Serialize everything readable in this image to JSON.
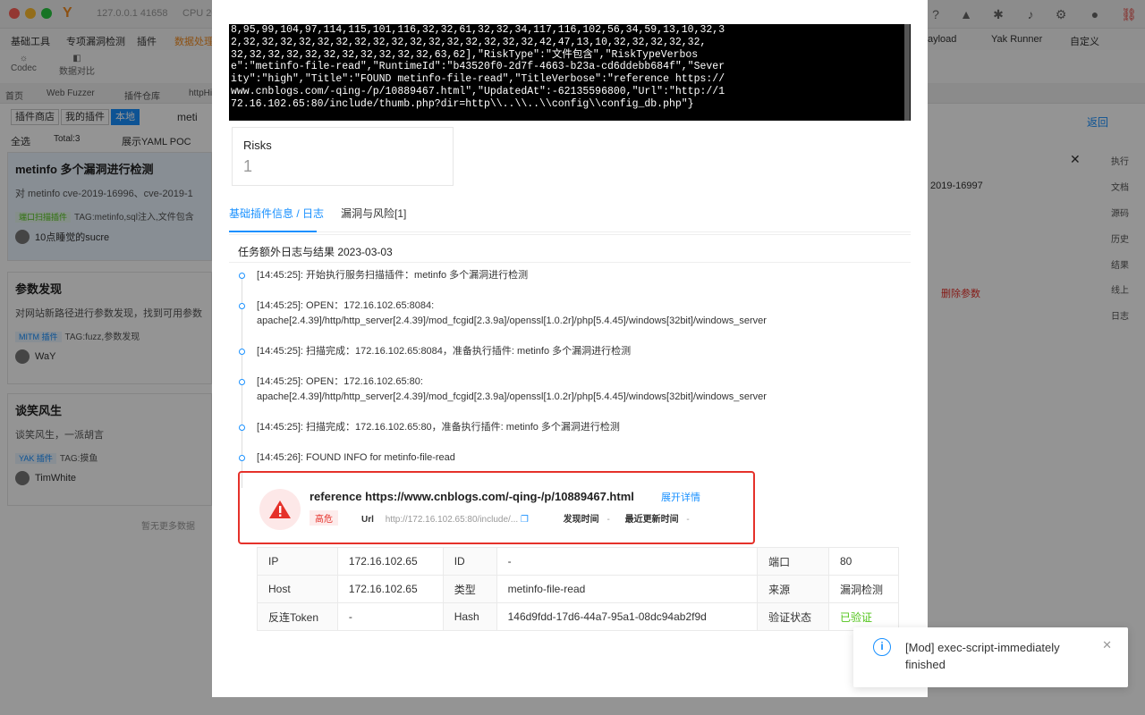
{
  "bg": {
    "address": "127.0.0.1 41658",
    "cpu": "CPU 20",
    "menu": [
      "基础工具",
      "专项漏洞检测",
      "插件",
      "数据处理"
    ],
    "menu_right": [
      "ayload",
      "Yak Runner",
      "自定义"
    ],
    "tools": [
      "Codec",
      "数据对比"
    ],
    "tabs": [
      "首页",
      "Web Fuzzer",
      "插件仓库",
      "httpHi"
    ],
    "plugin_tabs": [
      "插件商店",
      "我的插件",
      "本地"
    ],
    "search_value": "meti",
    "select_all": "全选",
    "total": "Total:3",
    "yaml_toggle": "展示YAML POC",
    "back_link": "返回",
    "cards": [
      {
        "title": "metinfo 多个漏洞进行检测",
        "desc": "对 metinfo cve-2019-16996、cve-2019-1",
        "tag": "端口扫描插件",
        "tags": "TAG:metinfo,sql注入,文件包含",
        "author": "10点睡觉的sucre"
      },
      {
        "title": "参数发现",
        "desc": "对网站新路径进行参数发现，找到可用参数",
        "tag": "MITM 插件",
        "tags": "TAG:fuzz,参数发现",
        "author": "WaY"
      },
      {
        "title": "谈笑风生",
        "desc": "谈笑风生，一派胡言",
        "tag": "YAK 插件",
        "tags": "TAG:摸鱼",
        "author": "TimWhite"
      }
    ],
    "no_more": "暂无更多数据",
    "right_field": "2019-16997",
    "delete_param": "删除参数",
    "side_tabs": [
      "执行",
      "文档",
      "源码",
      "历史",
      "结果",
      "线上",
      "日志"
    ]
  },
  "terminal_lines": [
    "8,95,99,104,97,114,115,101,116,32,32,61,32,32,34,117,116,102,56,34,59,13,10,32,3",
    "2,32,32,32,32,32,32,32,32,32,32,32,32,32,32,32,32,42,47,13,10,32,32,32,32,32,",
    "32,32,32,32,32,32,32,32,32,32,32,63,62],\"RiskType\":\"文件包含\",\"RiskTypeVerbos",
    "e\":\"metinfo-file-read\",\"RuntimeId\":\"b43520f0-2d7f-4663-b23a-cd6ddebb684f\",\"Sever",
    "ity\":\"high\",\"Title\":\"FOUND metinfo-file-read\",\"TitleVerbose\":\"reference https://",
    "www.cnblogs.com/-qing-/p/10889467.html\",\"UpdatedAt\":-62135596800,\"Url\":\"http://1",
    "72.16.102.65:80/include/thumb.php?dir=http\\\\..\\\\..\\\\config\\\\config_db.php\"}"
  ],
  "risks": {
    "label": "Risks",
    "value": "1"
  },
  "info_tabs": [
    "基础插件信息 / 日志",
    "漏洞与风险[1]"
  ],
  "log_header": "任务额外日志与结果  2023-03-03",
  "logs": [
    "[14:45:25]: 开始执行服务扫描插件：metinfo 多个漏洞进行检测",
    "[14:45:25]: OPEN：172.16.102.65:8084: apache[2.4.39]/http/http_server[2.4.39]/mod_fcgid[2.3.9a]/openssl[1.0.2r]/php[5.4.45]/windows[32bit]/windows_server",
    "[14:45:25]: 扫描完成：172.16.102.65:8084，准备执行插件: metinfo 多个漏洞进行检测",
    "[14:45:25]: OPEN：172.16.102.65:80: apache[2.4.39]/http/http_server[2.4.39]/mod_fcgid[2.3.9a]/openssl[1.0.2r]/php[5.4.45]/windows[32bit]/windows_server",
    "[14:45:25]: 扫描完成：172.16.102.65:80，准备执行插件: metinfo 多个漏洞进行检测",
    "[14:45:26]: FOUND INFO for metinfo-file-read"
  ],
  "risk_card": {
    "title": "reference https://www.cnblogs.com/-qing-/p/10889467.html",
    "expand": "展开详情",
    "severity": "高危",
    "url_label": "Url",
    "url_value": "http://172.16.102.65:80/include/...",
    "found_label": "发现时间",
    "found_value": "-",
    "updated_label": "最近更新时间",
    "updated_value": "-"
  },
  "details": [
    [
      "IP",
      "172.16.102.65",
      "ID",
      "-",
      "端口",
      "80"
    ],
    [
      "Host",
      "172.16.102.65",
      "类型",
      "metinfo-file-read",
      "来源",
      "漏洞检测"
    ],
    [
      "反连Token",
      "-",
      "Hash",
      "146d9fdd-17d6-44a7-95a1-08dc94ab2f9d",
      "验证状态",
      "已验证"
    ]
  ],
  "notice": {
    "text": "[Mod] exec-script-immediately finished"
  },
  "colors": {
    "accent": "#1890ff",
    "danger": "#e5312a",
    "success": "#52c41a"
  }
}
